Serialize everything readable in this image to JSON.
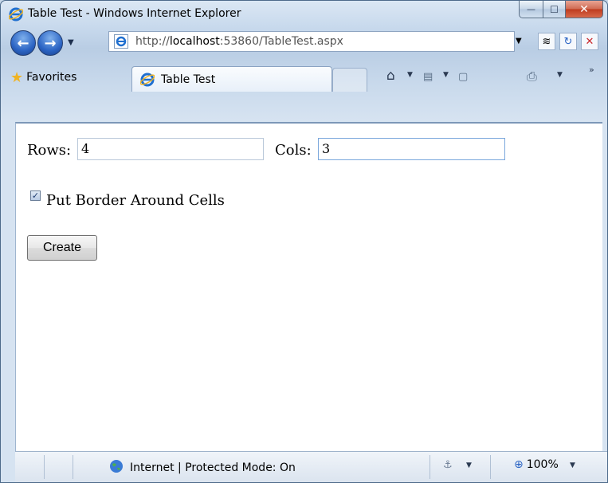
{
  "window": {
    "title": "Table Test - Windows Internet Explorer",
    "minimize_symbol": "—",
    "maximize_symbol": "☐",
    "close_symbol": "✕"
  },
  "navigation": {
    "address_url_prefix": "http://",
    "address_url_host": "localhost",
    "address_url_rest": ":53860/TableTest.aspx"
  },
  "favorites_bar": {
    "favorites_label": "Favorites",
    "tab_label": "Table Test"
  },
  "form": {
    "rows_label": "Rows:",
    "rows_value": "4",
    "cols_label": "Cols:",
    "cols_value": "3",
    "border_label": "Put Border Around Cells",
    "border_checked": true,
    "create_button": "Create"
  },
  "status_bar": {
    "zone_text": "Internet | Protected Mode: On",
    "zoom_text": "100%"
  },
  "colors": {
    "accent": "#2b64c4",
    "close_button": "#c9482c"
  }
}
